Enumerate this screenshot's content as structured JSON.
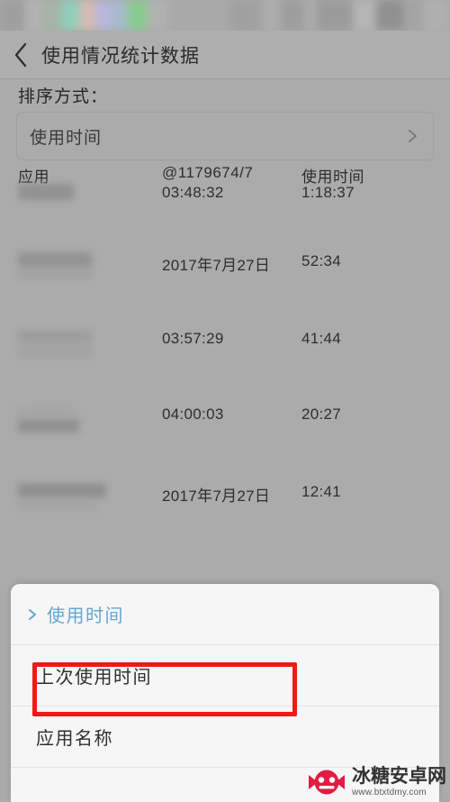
{
  "statusbar": {
    "redacted": true,
    "description": "blurred-status-bar"
  },
  "header": {
    "back_icon": "chevron-left-icon",
    "title": "使用情况统计数据"
  },
  "sort": {
    "label": "排序方式：",
    "selected_value": "使用时间",
    "chevron_icon": "chevron-right-icon"
  },
  "table": {
    "columns": [
      "应用",
      "@1179674/7",
      "使用时间"
    ],
    "rows": [
      {
        "app": "",
        "middle": "03:48:32",
        "duration": "1:18:37"
      },
      {
        "app": "",
        "middle": "2017年7月27日",
        "duration": "52:34"
      },
      {
        "app": "",
        "middle": "03:57:29",
        "duration": "41:44"
      },
      {
        "app": "",
        "middle": "04:00:03",
        "duration": "20:27"
      },
      {
        "app": "",
        "middle": "2017年7月27日",
        "duration": "12:41"
      }
    ]
  },
  "sheet": {
    "items": [
      {
        "label": "使用时间",
        "selected": true,
        "highlighted": false
      },
      {
        "label": "上次使用时间",
        "selected": false,
        "highlighted": true
      },
      {
        "label": "应用名称",
        "selected": false,
        "highlighted": false
      }
    ]
  },
  "annotation": {
    "type": "red-rectangle",
    "target": "上次使用时间",
    "color": "#ee1b14"
  },
  "watermark": {
    "name": "冰糖安卓网",
    "url": "www.btxtdmy.com",
    "color": "#e2143c"
  },
  "colors": {
    "page_background": "#ababab",
    "titlebar_background": "#aeaeae",
    "sheet_background": "#f6f6f6",
    "accent_blue": "#63a8d4",
    "annotation_red": "#ee1b14"
  }
}
